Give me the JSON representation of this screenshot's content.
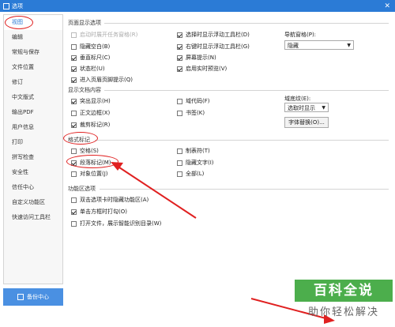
{
  "window": {
    "title": "选项",
    "close": "✕"
  },
  "sidebar": {
    "items": [
      {
        "label": "视图"
      },
      {
        "label": "编辑"
      },
      {
        "label": "常规与保存"
      },
      {
        "label": "文件位置"
      },
      {
        "label": "修订"
      },
      {
        "label": "中文版式"
      },
      {
        "label": "输出PDF"
      },
      {
        "label": "用户信息"
      },
      {
        "label": "打印"
      },
      {
        "label": "拼写检查"
      },
      {
        "label": "安全性"
      },
      {
        "label": "信任中心"
      },
      {
        "label": "自定义功能区"
      },
      {
        "label": "快速访问工具栏"
      }
    ],
    "active": "视图",
    "backup_label": "备份中心"
  },
  "page_display": {
    "title": "页面显示选项",
    "col1": [
      {
        "label": "启动时展开任务窗格(R)",
        "checked": false,
        "disabled": true
      },
      {
        "label": "隐藏空白(B)",
        "checked": false
      },
      {
        "label": "垂直标尺(C)",
        "checked": true
      },
      {
        "label": "状态栏(U)",
        "checked": true
      },
      {
        "label": "进入页眉页脚提示(Q)",
        "checked": true
      }
    ],
    "col2": [
      {
        "label": "选择时显示浮动工具栏(D)",
        "checked": true
      },
      {
        "label": "右键时显示浮动工具栏(G)",
        "checked": true
      },
      {
        "label": "屏幕提示(N)",
        "checked": true
      },
      {
        "label": "启用实时预览(V)",
        "checked": true
      }
    ],
    "nav_label": "导航窗格(P):",
    "nav_value": "隐藏"
  },
  "doc_content": {
    "title": "显示文档内容",
    "col1": [
      {
        "label": "突出显示(H)",
        "checked": true
      },
      {
        "label": "正文边框(X)",
        "checked": false
      },
      {
        "label": "裁剪标记(R)",
        "checked": true
      }
    ],
    "col2": [
      {
        "label": "域代码(F)",
        "checked": false
      },
      {
        "label": "书签(K)",
        "checked": false
      }
    ],
    "shading_label": "域底纹(E):",
    "shading_value": "选取时显示",
    "font_btn": "字体替换(O)..."
  },
  "format_marks": {
    "title": "格式标记",
    "col1": [
      {
        "label": "空格(S)",
        "checked": false
      },
      {
        "label": "段落标记(M)",
        "checked": true
      },
      {
        "label": "对象位置(J)",
        "checked": false
      }
    ],
    "col2": [
      {
        "label": "制表符(T)",
        "checked": false
      },
      {
        "label": "隐藏文字(I)",
        "checked": false
      },
      {
        "label": "全部(L)",
        "checked": false
      }
    ]
  },
  "ribbon": {
    "title": "功能区选项",
    "items": [
      {
        "label": "双击选项卡时隐藏功能区(A)",
        "checked": false
      },
      {
        "label": "单击方框时打勾(O)",
        "checked": true
      },
      {
        "label": "打开文件，展示智能识别目录(W)",
        "checked": false
      }
    ]
  },
  "watermark": {
    "top": "百科全说",
    "bottom": "助你轻松解决"
  },
  "colors": {
    "accent": "#2b7bd6",
    "annotation": "#e02020",
    "watermark": "#4cae4c"
  }
}
